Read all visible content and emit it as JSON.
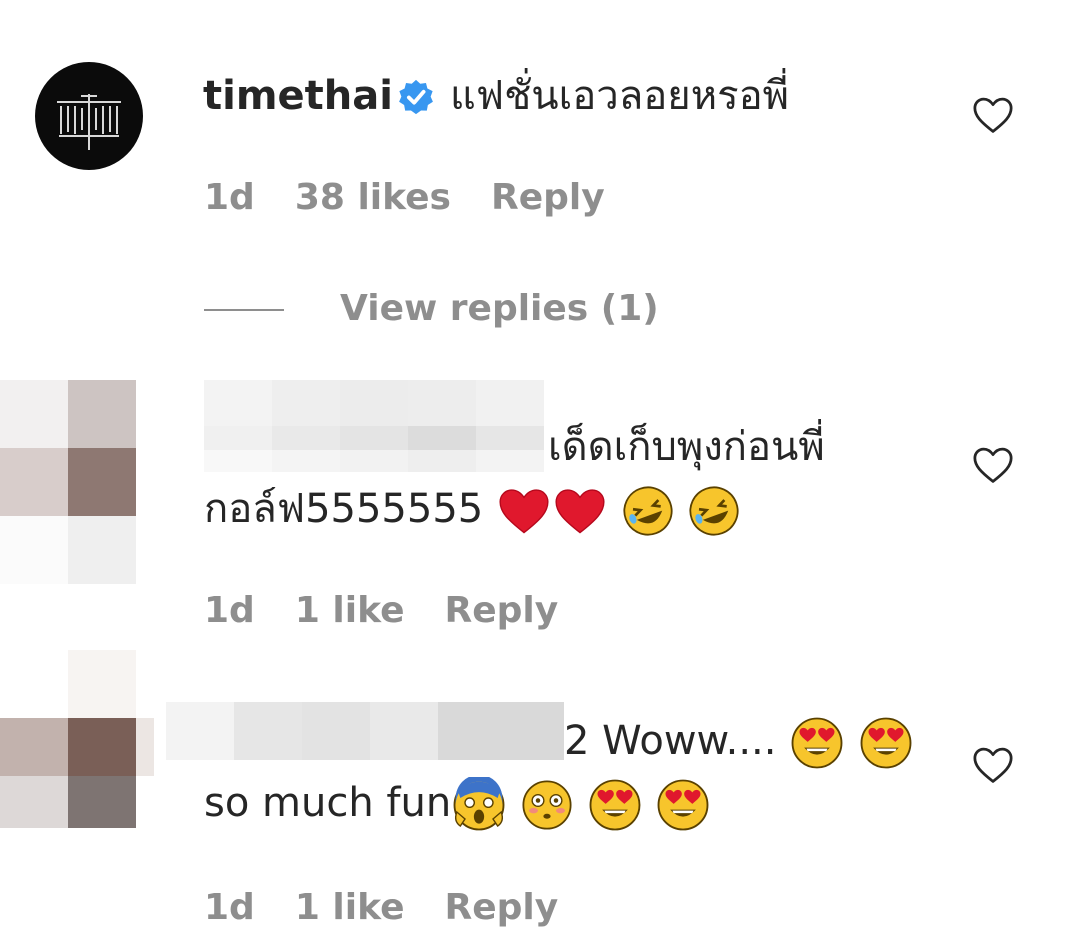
{
  "comments": [
    {
      "username": "timethai",
      "text": "แฟชั่นเอวลอยหรอพี่",
      "time": "1d",
      "likes": "38 likes",
      "reply_label": "Reply",
      "view_replies": "View replies (1)"
    },
    {
      "text_line1": "เด็ดเก็บพุงก่อนพี่",
      "text_line2": "กอล์ฟ5555555",
      "time": "1d",
      "likes": "1 like",
      "reply_label": "Reply"
    },
    {
      "text_line1": "2 Woww....",
      "text_line2": "so much fun",
      "time": "1d",
      "likes": "1 like",
      "reply_label": "Reply"
    }
  ],
  "colors": {
    "verified": "#3897f0",
    "muted": "#8e8e8e",
    "text": "#262626"
  }
}
